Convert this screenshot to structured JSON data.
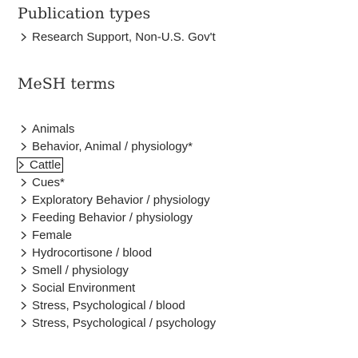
{
  "publication_types": {
    "heading": "Publication types",
    "items": [
      {
        "label": "Research Support, Non-U.S. Gov't"
      }
    ]
  },
  "mesh_terms": {
    "heading": "MeSH terms",
    "items": [
      {
        "label": "Animals"
      },
      {
        "label": "Behavior, Animal / physiology*"
      },
      {
        "label": "Cattle"
      },
      {
        "label": "Cues*"
      },
      {
        "label": "Exploratory Behavior / physiology"
      },
      {
        "label": "Feeding Behavior / physiology"
      },
      {
        "label": "Female"
      },
      {
        "label": "Hydrocortisone / blood"
      },
      {
        "label": "Smell / physiology"
      },
      {
        "label": "Social Environment"
      },
      {
        "label": "Stress, Psychological / blood"
      },
      {
        "label": "Stress, Psychological / psychology"
      }
    ]
  },
  "icons": {
    "expand": "chevron-right-icon"
  }
}
